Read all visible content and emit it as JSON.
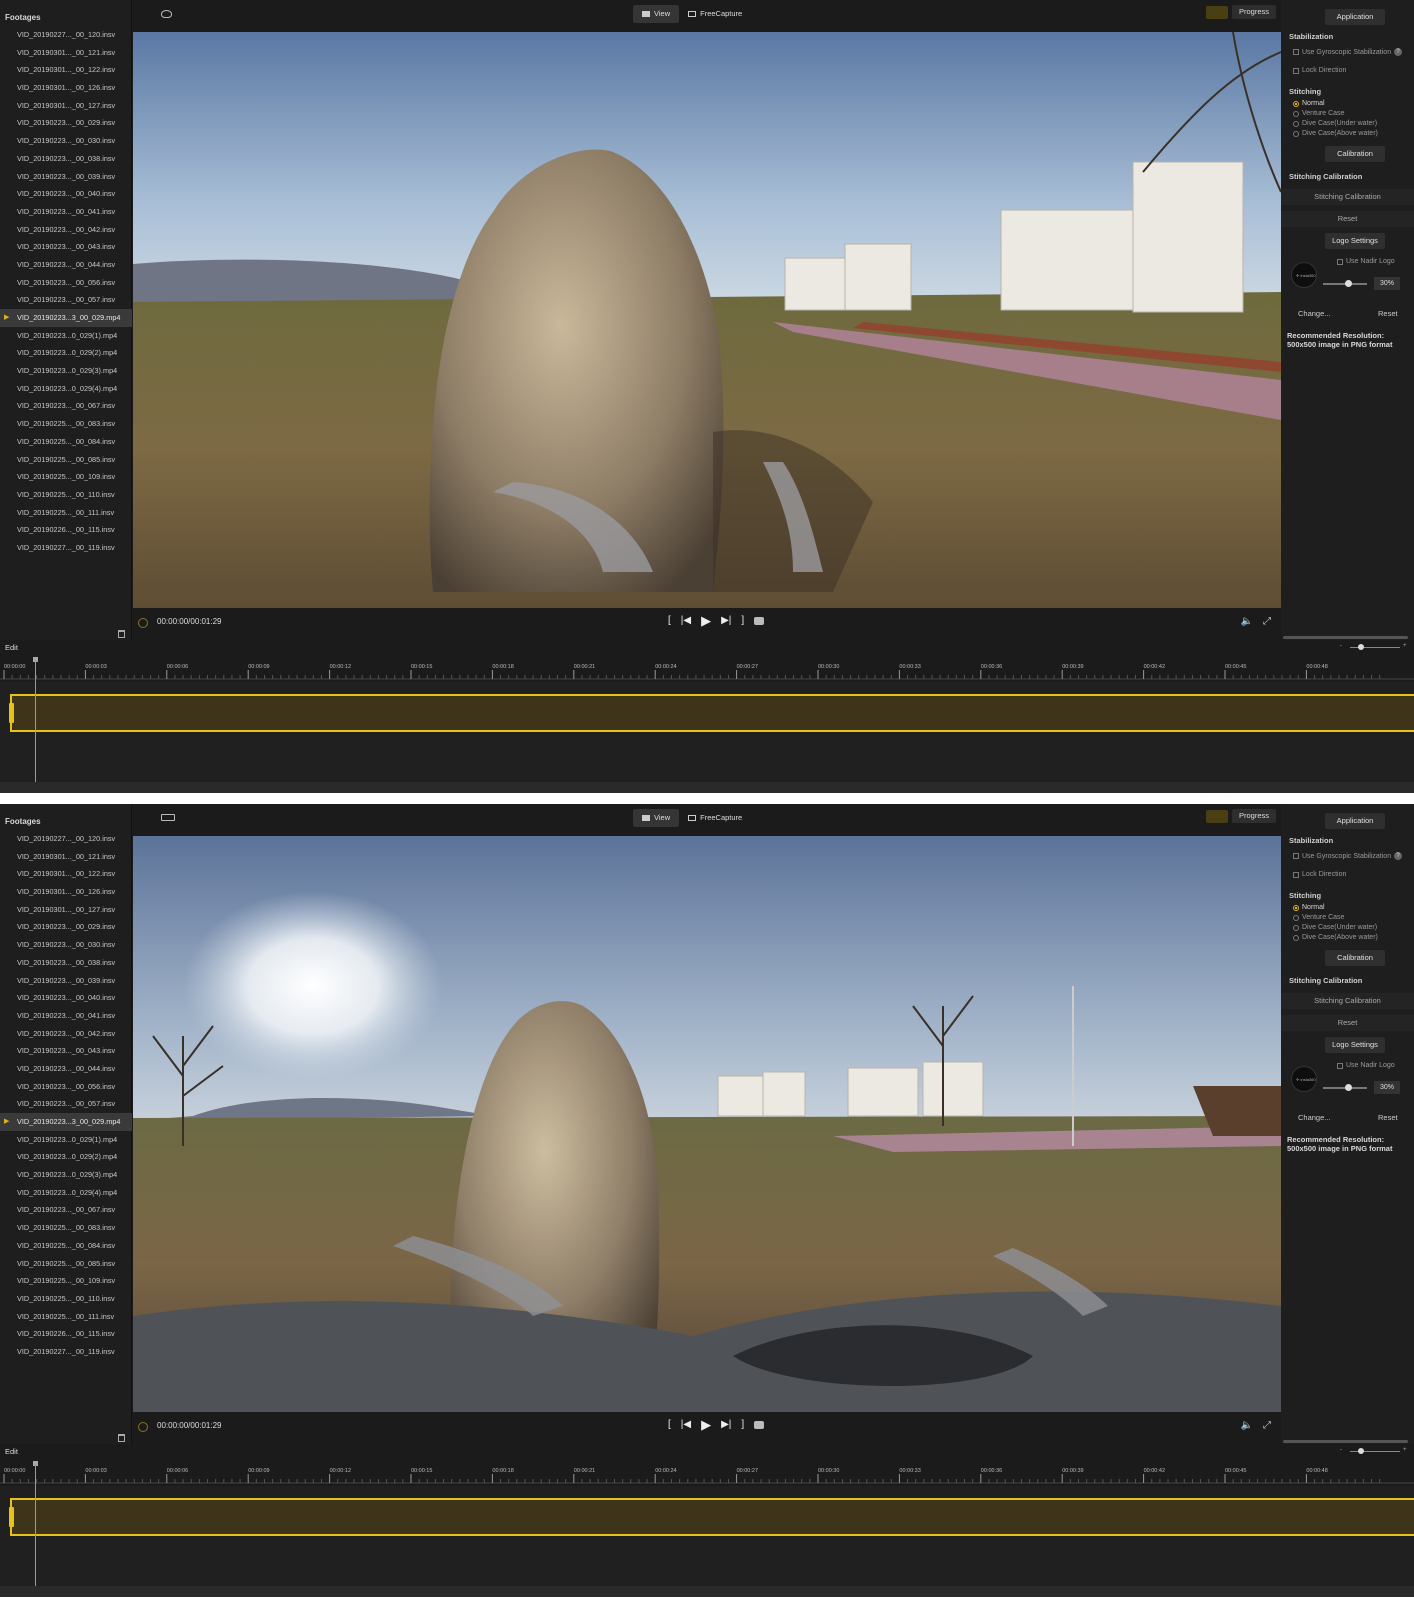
{
  "sidebar": {
    "title": "Footages",
    "files": [
      {
        "name": "VID_20190227..._00_120.insv",
        "active": false
      },
      {
        "name": "VID_20190301..._00_121.insv",
        "active": false
      },
      {
        "name": "VID_20190301..._00_122.insv",
        "active": false
      },
      {
        "name": "VID_20190301..._00_126.insv",
        "active": false
      },
      {
        "name": "VID_20190301..._00_127.insv",
        "active": false
      },
      {
        "name": "VID_20190223..._00_029.insv",
        "active": false
      },
      {
        "name": "VID_20190223..._00_030.insv",
        "active": false
      },
      {
        "name": "VID_20190223..._00_038.insv",
        "active": false
      },
      {
        "name": "VID_20190223..._00_039.insv",
        "active": false
      },
      {
        "name": "VID_20190223..._00_040.insv",
        "active": false
      },
      {
        "name": "VID_20190223..._00_041.insv",
        "active": false
      },
      {
        "name": "VID_20190223..._00_042.insv",
        "active": false
      },
      {
        "name": "VID_20190223..._00_043.insv",
        "active": false
      },
      {
        "name": "VID_20190223..._00_044.insv",
        "active": false
      },
      {
        "name": "VID_20190223..._00_056.insv",
        "active": false
      },
      {
        "name": "VID_20190223..._00_057.insv",
        "active": false
      },
      {
        "name": "VID_20190223...3_00_029.mp4",
        "active": true
      },
      {
        "name": "VID_20190223...0_029(1).mp4",
        "active": false
      },
      {
        "name": "VID_20190223...0_029(2).mp4",
        "active": false
      },
      {
        "name": "VID_20190223...0_029(3).mp4",
        "active": false
      },
      {
        "name": "VID_20190223...0_029(4).mp4",
        "active": false
      },
      {
        "name": "VID_20190223..._00_067.insv",
        "active": false
      },
      {
        "name": "VID_20190225..._00_083.insv",
        "active": false
      },
      {
        "name": "VID_20190225..._00_084.insv",
        "active": false
      },
      {
        "name": "VID_20190225..._00_085.insv",
        "active": false
      },
      {
        "name": "VID_20190225..._00_109.insv",
        "active": false
      },
      {
        "name": "VID_20190225..._00_110.insv",
        "active": false
      },
      {
        "name": "VID_20190225..._00_111.insv",
        "active": false
      },
      {
        "name": "VID_20190226..._00_115.insv",
        "active": false
      },
      {
        "name": "VID_20190227..._00_119.insv",
        "active": false
      }
    ]
  },
  "topbar": {
    "view_label": "View",
    "freecapture_label": "FreeCapture",
    "progress_label": "Progress"
  },
  "player": {
    "timecode": "00:00:00/00:01:29"
  },
  "right_panel": {
    "application_label": "Application",
    "stabilization_title": "Stabilization",
    "use_gyro_label": "Use Gyroscopic Stabilization",
    "lock_direction_label": "Lock Direction",
    "stitching_title": "Stitching",
    "stitching_options": [
      "Normal",
      "Venture Case",
      "Dive Case(Under water)",
      "Dive Case(Above water)"
    ],
    "stitching_selected": "Normal",
    "calibration_label": "Calibration",
    "stitching_calibration_title": "Stitching Calibration",
    "stitching_calibration_button": "Stitching Calibration",
    "reset_label": "Reset",
    "logo_settings_label": "Logo Settings",
    "use_nadir_logo_label": "Use Nadir Logo",
    "logo_text": "✢ insta360",
    "logo_size_percent": "30%",
    "change_label": "Change...",
    "logo_reset_label": "Reset",
    "recommended_note": "Recommended Resolution: 500x500 image in PNG format"
  },
  "edit": {
    "title": "Edit",
    "ruler_ticks": [
      "00:00:00",
      "00:00:03",
      "00:00:06",
      "00:00:09",
      "00:00:12",
      "00:00:15",
      "00:00:18",
      "00:00:21",
      "00:00:24",
      "00:00:27",
      "00:00:30",
      "00:00:33",
      "00:00:36",
      "00:00:39",
      "00:00:42",
      "00:00:45",
      "00:00:48"
    ],
    "zoom_minus": "-",
    "zoom_plus": "+"
  },
  "colors": {
    "accent": "#e8c11a",
    "clip_fill": "#3e3419",
    "background": "#1b1b1b"
  }
}
